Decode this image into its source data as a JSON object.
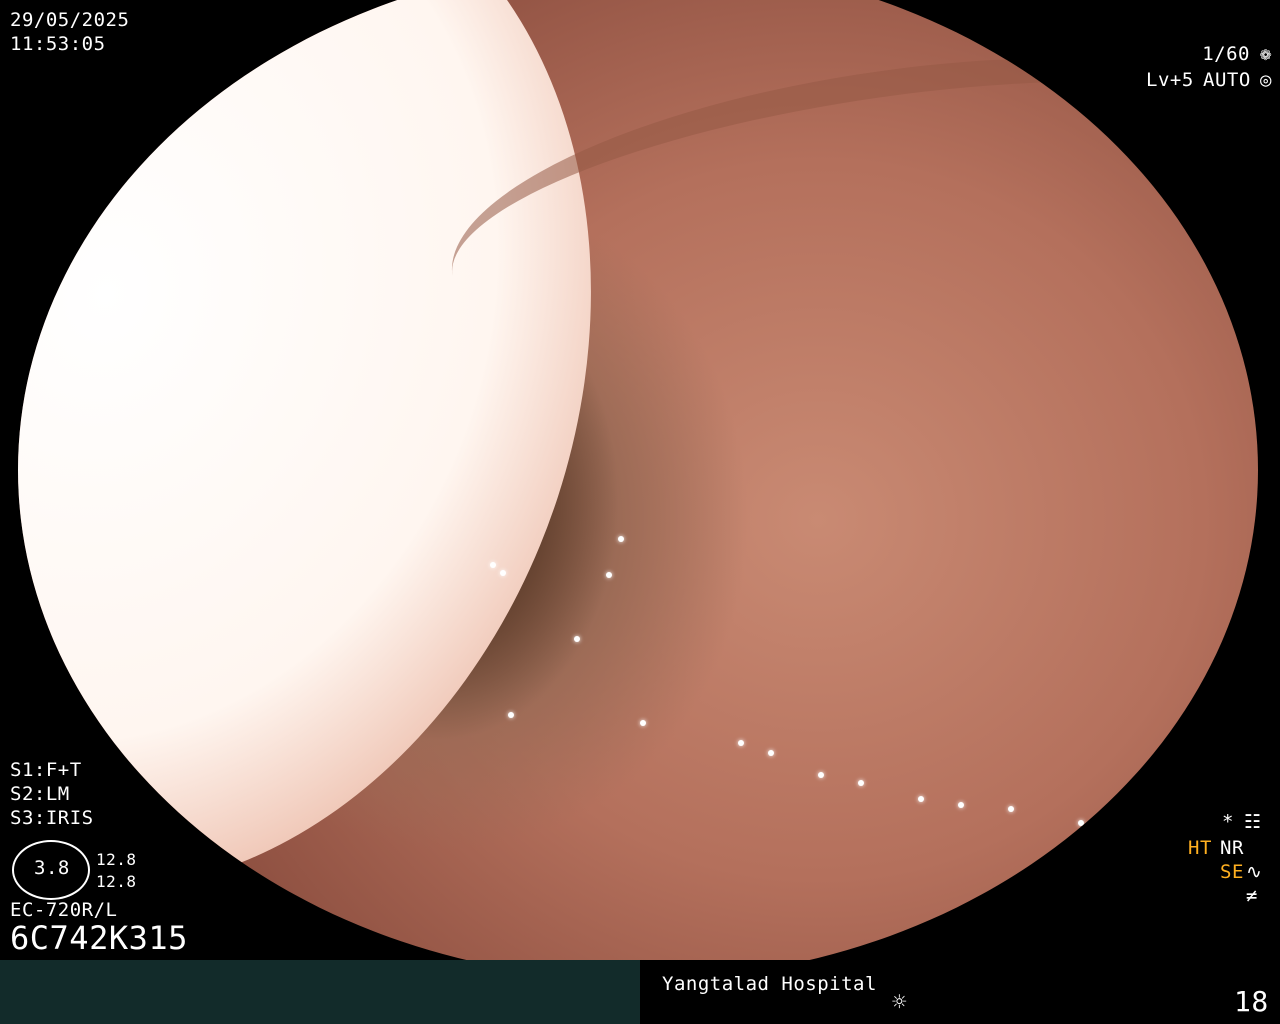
{
  "osd": {
    "date": "29/05/2025",
    "time": "11:53:05",
    "shutter": "1/60",
    "level": "Lv+5",
    "mode": "AUTO",
    "shutter_icon": "aperture-icon",
    "mode_icon": "camera-icon",
    "s1": "S1:F+T",
    "s2": "S2:LM",
    "s3": "S3:IRIS",
    "dial_value": "3.8",
    "dial_top": "12.8",
    "dial_bottom": "12.8",
    "scope_model": "EC-720R/L",
    "scope_serial": "6C742K315",
    "star": "*",
    "ht": "HT",
    "nr": "NR",
    "se": "SE",
    "not_equal": "≠"
  },
  "footer": {
    "hospital": "Yangtalad Hospital",
    "brightness_icon": "sun-icon",
    "page_number": "18"
  },
  "colors": {
    "accent_orange": "#ffb020",
    "bar_dark_teal": "#122b2a"
  }
}
